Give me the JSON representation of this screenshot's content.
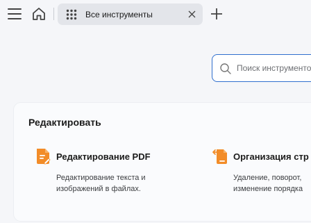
{
  "window": {
    "tab_label": "Все инструменты"
  },
  "search": {
    "placeholder": "Поиск инструментов"
  },
  "section": {
    "title": "Редактировать",
    "tools": [
      {
        "title": "Редактирование PDF",
        "description": "Редактирование текста и\nизображений в файлах.",
        "icon": "edit-pdf-icon",
        "color": "#f28c28"
      },
      {
        "title": "Организация стр",
        "description": "Удаление, поворот,\nизменение порядка",
        "icon": "organize-pages-icon",
        "color": "#f28c28"
      }
    ]
  },
  "colors": {
    "accent": "#2f6fce",
    "tool_icon": "#f28c28"
  }
}
